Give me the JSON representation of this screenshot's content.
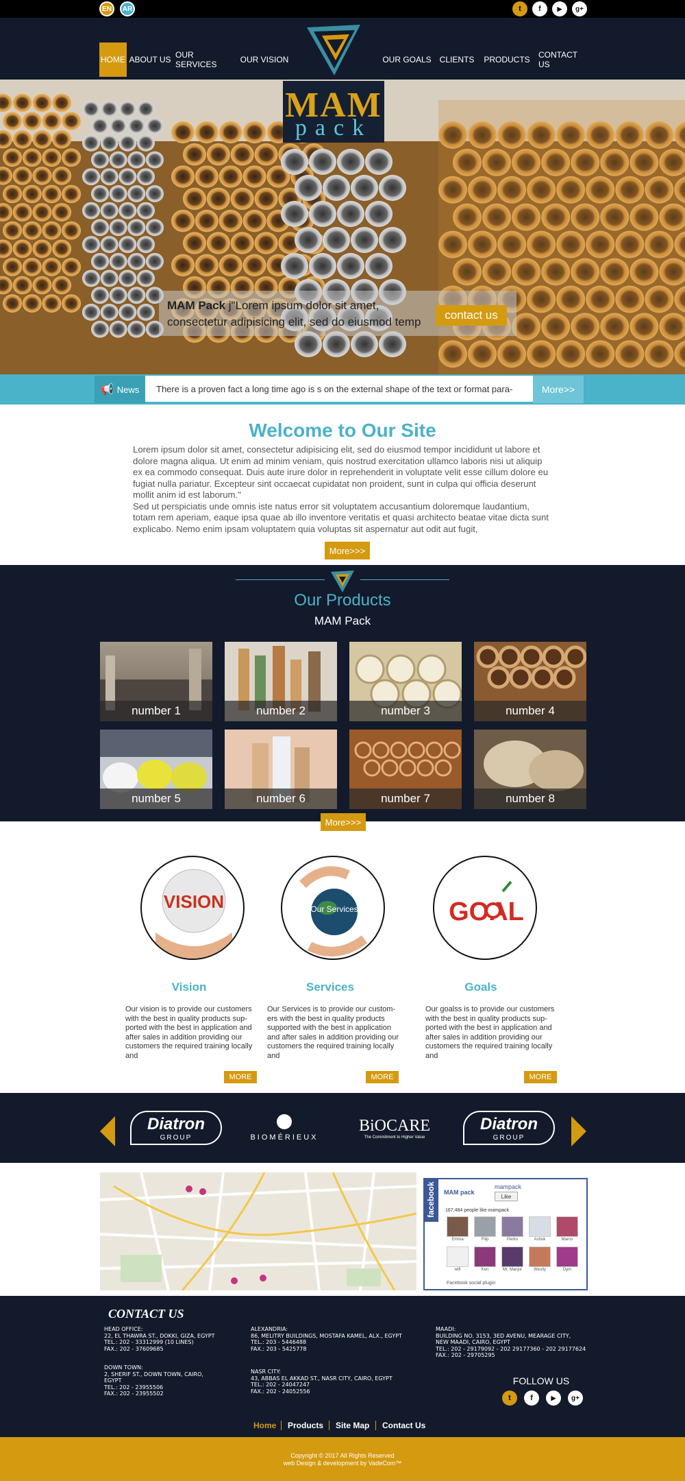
{
  "top": {
    "languages": [
      "EN",
      "AR"
    ],
    "social_icons": [
      "twitter-icon",
      "facebook-icon",
      "youtube-icon",
      "google-plus-icon"
    ],
    "social_glyphs": [
      "t",
      "f",
      "▶",
      "g+"
    ]
  },
  "nav": {
    "items": [
      "HOME",
      "ABOUT US",
      "OUR SERVICES",
      "OUR VISION",
      "OUR GOALS",
      "CLIENTS",
      "PRODUCTS",
      "CONTACT US"
    ],
    "active": "HOME"
  },
  "logo": {
    "line1": "MAM",
    "line2": "pack"
  },
  "hero": {
    "brand": "MAM Pack",
    "caption": " j\"Lorem ipsum dolor sit amet, consectetur adipisicing elit, sed do eiusmod temp",
    "button": "contact us"
  },
  "news": {
    "label": "News",
    "text": "There is a proven fact a long time ago is s on the external shape of the text or format para-",
    "more": "More>>"
  },
  "welcome": {
    "title": "Welcome to Our Site",
    "paragraph1": "Lorem ipsum dolor sit amet, consectetur adipisicing elit, sed do eiusmod tempor incididunt ut labore et dolore magna aliqua. Ut enim ad minim veniam, quis nostrud exercitation ullamco laboris nisi ut aliquip ex ea commodo consequat. Duis aute irure dolor in reprehenderit in voluptate velit esse cillum dolore eu fugiat nulla pariatur. Excepteur sint occaecat cupidatat non proident, sunt in culpa qui officia deserunt mollit anim id est laborum.\"",
    "paragraph2": "Sed ut perspiciatis unde omnis iste natus error sit voluptatem accusantium doloremque laudantium, totam rem aperiam, eaque ipsa quae ab illo inventore veritatis et quasi architecto beatae vitae dicta sunt explicabo. Nemo enim ipsam voluptatem quia voluptas sit aspernatur aut odit aut fugit,",
    "button": "More>>>"
  },
  "products": {
    "title": "Our Products",
    "subtitle": "MAM Pack",
    "items": [
      "number 1",
      "number 2",
      "number 3",
      "number 4",
      "number 5",
      "number 6",
      "number 7",
      "number 8"
    ],
    "button": "More>>>"
  },
  "features": [
    {
      "title": "Vision",
      "image_text": "VISION",
      "text": "Our vision is to provide our customers with the best in quality products sup-ported with the best in application and after sales in addition providing our customers the required training locally and",
      "button": "MORE"
    },
    {
      "title": "Services",
      "image_text": "Our Services",
      "text": "Our Services is to provide our custom-ers with the best in quality products supported with the best in application and after sales in addition providing our customers the required training locally and",
      "button": "MORE"
    },
    {
      "title": "Goals",
      "image_text": "GOAL",
      "text": "Our goalss is to provide our customers with the best in quality products sup-ported with the best in application and after sales in addition providing our customers the required training locally and",
      "button": "MORE"
    }
  ],
  "clients": [
    {
      "name": "Diatron",
      "sub": "GROUP"
    },
    {
      "name": "BIOMÉRIEUX",
      "sub": ""
    },
    {
      "name": "BiOCARE",
      "sub": "The Commitment to Higher Value"
    },
    {
      "name": "Diatron",
      "sub": "GROUP"
    }
  ],
  "facebook": {
    "tab": "facebook",
    "page": "mampack",
    "logo_text": "MAM pack",
    "like": "Like",
    "count": "167,484 people like mampack",
    "people": [
      "Emma",
      "Filip",
      "Pedro",
      "Ashok",
      "Marco",
      "wifi",
      "Ken",
      "Mr. Manjur",
      "Westly",
      "Dym"
    ],
    "plugin": "Facebook social plugin"
  },
  "contact": {
    "title": "CONTACT US",
    "offices": [
      "HEAD OFFICE:\n22, EL THAWRA ST., DOKKI, GIZA, EGYPT\nTEL.: 202 - 33312999 (10 LINES)\nFAX.: 202 - 37609685",
      "ALEXANDRIA:\n86, MELITRY BUILDINGS, MOSTAFA KAMEL, ALX., EGYPT\nTEL.: 203 - 5446488\nFAX.: 203 - 5425778",
      "MAADI:\nBUILDING NO. 3153, 3ED AVENU, MEARAGE CITY,\nNEW MAADI, CAIRO, EGYPT\nTEL.: 202 - 29179092 - 202 29177360 - 202 29177624\nFAX.: 202 - 29705295",
      "DOWN TOWN:\n2, SHERIF ST., DOWN TOWN, CAIRO,\nEGYPT\nTEL.: 202 - 23955506\nFAX.: 202 - 23955502",
      "NASR CITY:\n43, ABBAS EL AKKAD ST., NASR CITY, CAIRO, EGYPT\nTEL.: 202 - 24047247\nFAX.: 202 - 24052556"
    ],
    "follow": "FOLLOW US"
  },
  "footer_nav": [
    "Home",
    "Products",
    "Site Map",
    "Contact Us"
  ],
  "copyright": {
    "line1": "Copyright © 2017 All Rights Reserved",
    "line2": "web Design & development by VadeCom™"
  },
  "colors": {
    "gold": "#d49a10",
    "navy": "#131a2b",
    "teal": "#4ab2c9"
  }
}
